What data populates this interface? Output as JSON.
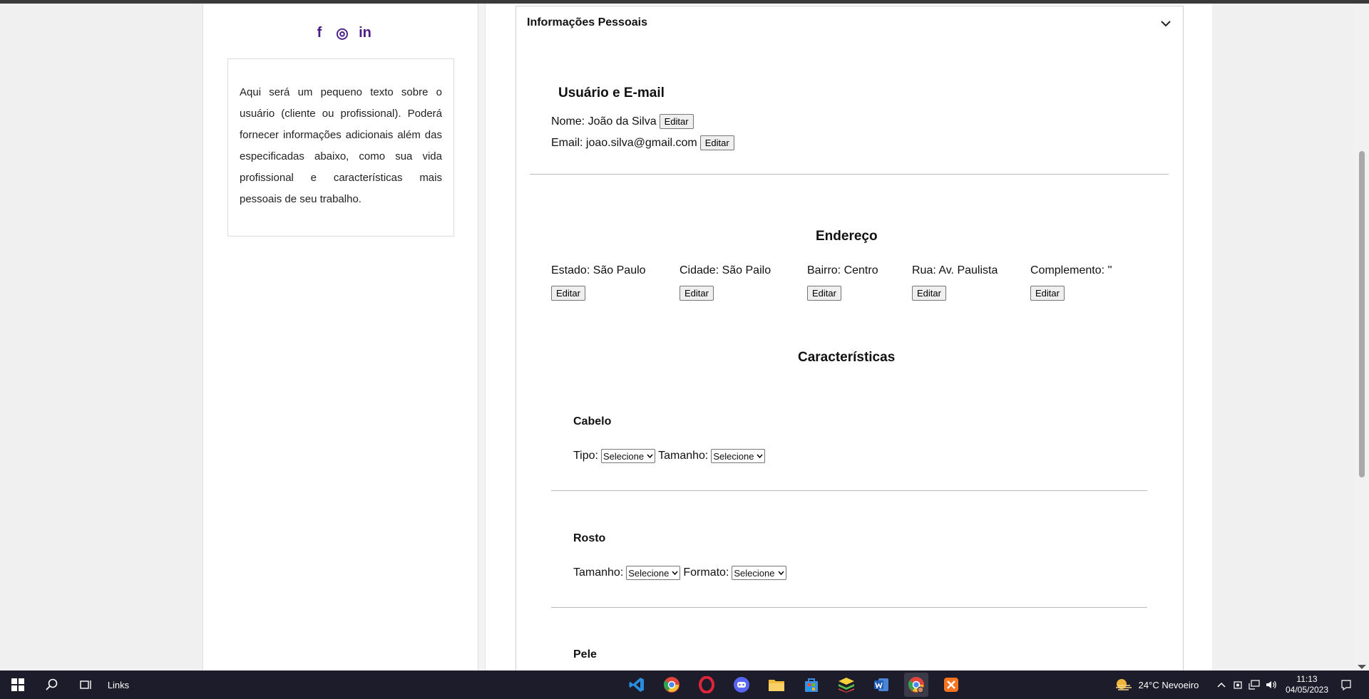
{
  "profile": {
    "social": [
      "f",
      "◎",
      "in"
    ],
    "bio": "Aqui será um pequeno texto sobre o usuário (cliente ou profissional). Poderá fornecer informações adicionais além das especificadas abaixo, como sua vida profissional e características mais pessoais de seu trabalho."
  },
  "panel": {
    "title": "Informações Pessoais",
    "user_section": {
      "title": "Usuário e E-mail",
      "name_label": "Nome: João da Silva",
      "email_label": "Email: joao.silva@gmail.com",
      "edit": "Editar"
    },
    "address": {
      "title": "Endereço",
      "fields": [
        {
          "label": "Estado: São Paulo",
          "edit": "Editar"
        },
        {
          "label": "Cidade: São Pailo",
          "edit": "Editar"
        },
        {
          "label": "Bairro: Centro",
          "edit": "Editar"
        },
        {
          "label": "Rua: Av. Paulista",
          "edit": "Editar"
        },
        {
          "label": "Complemento: ''",
          "edit": "Editar"
        }
      ]
    },
    "characteristics": {
      "title": "Características",
      "groups": [
        {
          "title": "Cabelo",
          "field1": "Tipo:",
          "field2": "Tamanho:",
          "select": "Selecione"
        },
        {
          "title": "Rosto",
          "field1": "Tamanho:",
          "field2": "Formato:",
          "select": "Selecione"
        },
        {
          "title": "Pele"
        }
      ]
    }
  },
  "taskbar": {
    "search_label": "Links",
    "weather": "24°C  Nevoeiro",
    "time": "11:13",
    "date": "04/05/2023"
  }
}
